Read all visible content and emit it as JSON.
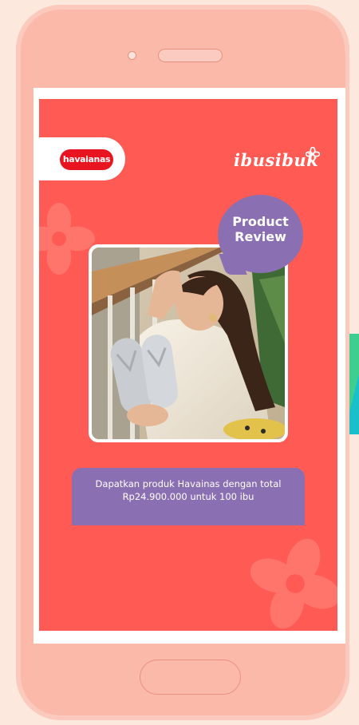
{
  "screen": {
    "background_color": "#ff5a53",
    "brand_logo_text": "havaianas",
    "brand_logo_color": "#e8141f",
    "partner_logo_text": "ibusibuk",
    "badge": {
      "line1": "Product",
      "line2": "Review",
      "color": "#8b6fb3"
    },
    "caption": {
      "line1": "Dapatkan produk Havainas dengan total",
      "line2": "Rp24.900.000 untuk 100 ibu"
    }
  },
  "device": {
    "frame_color": "#fbb9aa",
    "page_background": "#fde8de"
  },
  "icons": [
    "flower-icon",
    "camera-icon",
    "speaker-icon",
    "home-button"
  ]
}
